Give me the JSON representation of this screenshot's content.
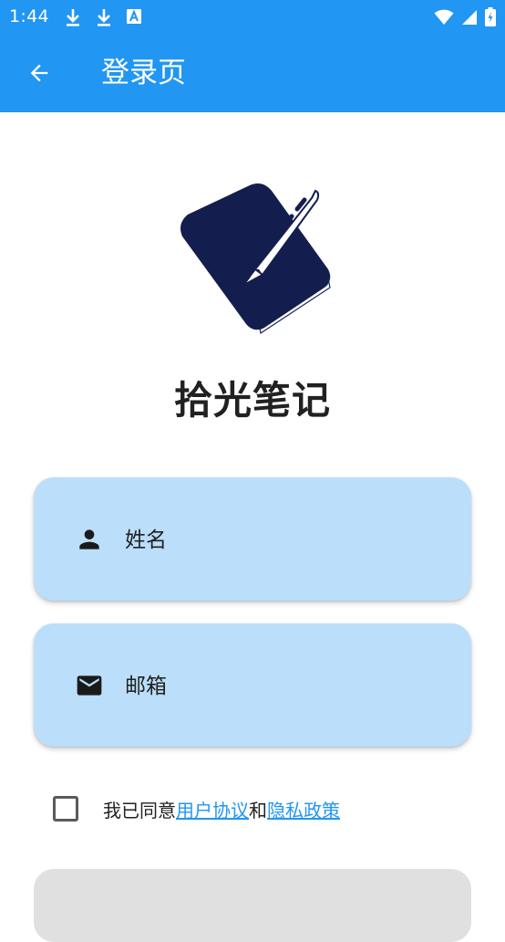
{
  "status_bar": {
    "time": "1:44",
    "icons_left": [
      "download-icon",
      "download-icon",
      "text-notification-icon"
    ],
    "icons_right": [
      "wifi-icon",
      "signal-icon",
      "battery-icon"
    ]
  },
  "app_bar": {
    "title": "登录页",
    "back_icon": "arrow-back-icon",
    "color": "#2196F3"
  },
  "brand": {
    "app_name": "拾光笔记",
    "logo_icon": "notebook-pen-logo"
  },
  "form": {
    "name_field": {
      "placeholder": "姓名",
      "value": "",
      "icon": "person-icon"
    },
    "email_field": {
      "placeholder": "邮箱",
      "value": "",
      "icon": "mail-icon"
    },
    "field_bg": "#BBDEFA"
  },
  "agreement": {
    "checked": false,
    "prefix": "我已同意",
    "user_agreement": "用户协议",
    "connector": "和",
    "privacy_policy": "隐私政策",
    "link_color": "#2196F3"
  }
}
